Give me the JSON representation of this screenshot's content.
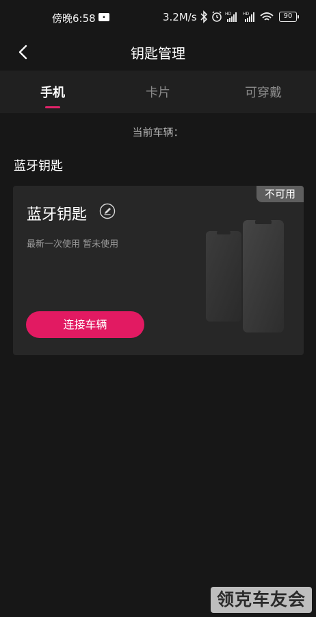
{
  "status_bar": {
    "time": "傍晚6:58",
    "speed": "3.2M/s",
    "battery": "90",
    "icons": [
      "bluetooth-icon",
      "alarm-icon",
      "signal-hd-icon",
      "signal-hd-icon",
      "wifi-icon",
      "battery-icon"
    ]
  },
  "header": {
    "title": "钥匙管理",
    "back_icon": "chevron-left-icon"
  },
  "tabs": [
    {
      "label": "手机",
      "active": true
    },
    {
      "label": "卡片",
      "active": false
    },
    {
      "label": "可穿戴",
      "active": false
    }
  ],
  "current_vehicle": "当前车辆：",
  "section_title": "蓝牙钥匙",
  "card": {
    "badge": "不可用",
    "title": "蓝牙钥匙",
    "edit_icon": "pencil-icon",
    "last_used": "最新一次使用 暂未使用",
    "button": "连接车辆"
  },
  "watermark": "领克车友会",
  "colors": {
    "background": "#171717",
    "tab_bar": "#202020",
    "card": "#272727",
    "accent": "#e21a62",
    "badge": "#5e5e5e"
  }
}
